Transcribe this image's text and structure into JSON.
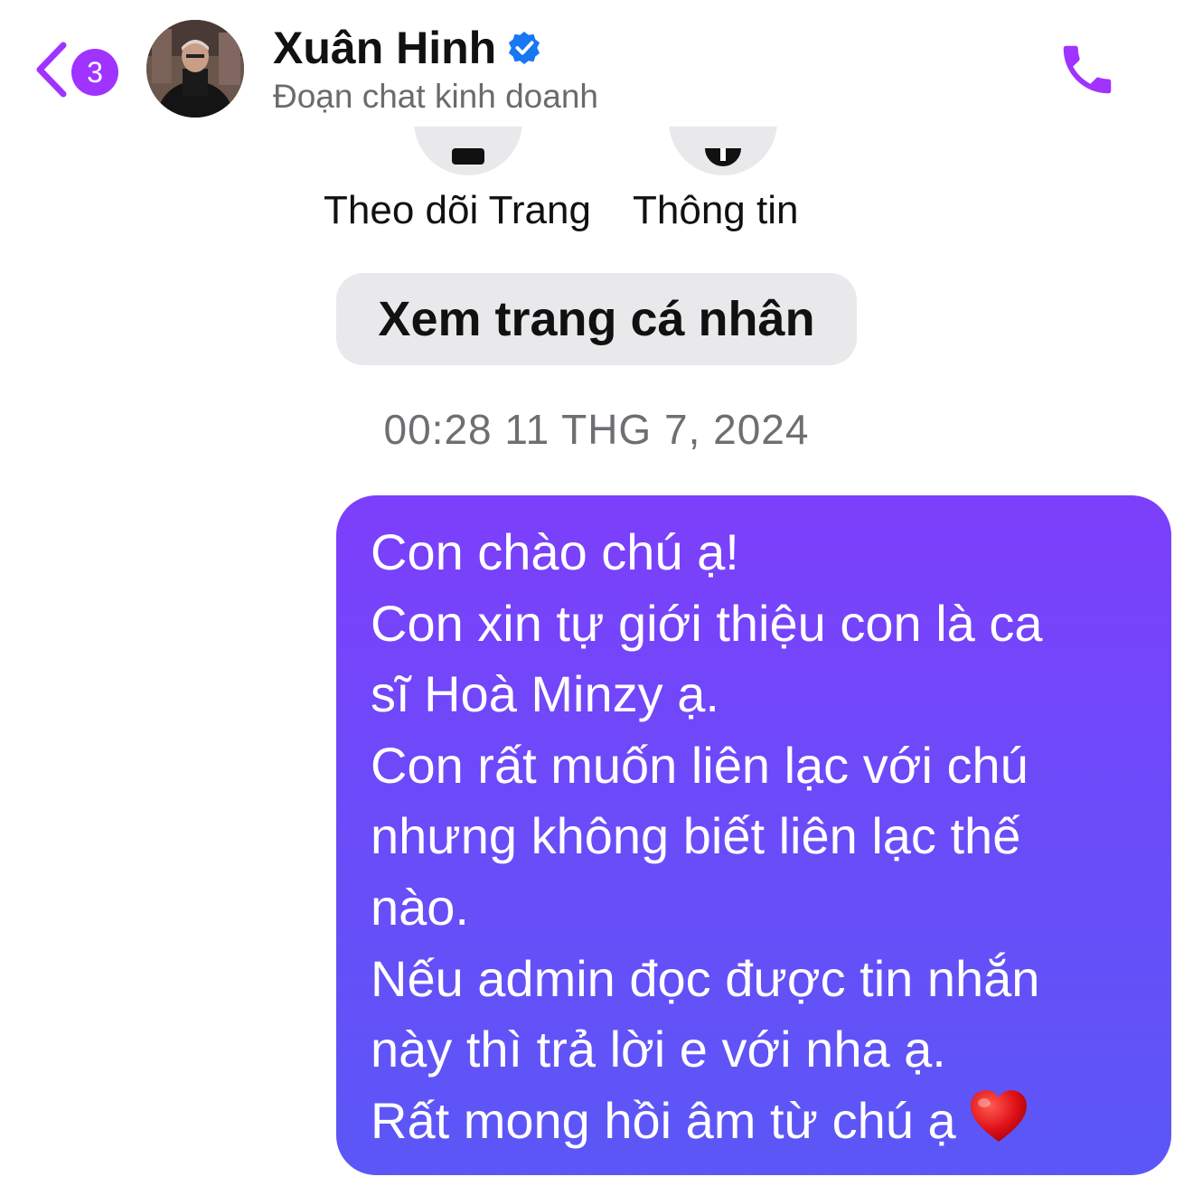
{
  "header": {
    "unread_count": "3",
    "contact_name": "Xuân Hinh",
    "contact_subtitle": "Đoạn chat kinh doanh",
    "icons": {
      "back": "chevron-left-icon",
      "verified": "verified-badge-icon",
      "call": "phone-icon"
    }
  },
  "profile_actions": {
    "follow_label": "Theo dõi Trang",
    "info_label": "Thông tin",
    "view_profile_label": "Xem trang cá nhân"
  },
  "conversation": {
    "timestamp": "00:28 11 THG 7, 2024",
    "message": {
      "lines": [
        "Con chào chú ạ!",
        "Con xin tự giới thiệu con là ca",
        "sĩ Hoà Minzy ạ.",
        "Con rất muốn liên lạc với chú",
        "nhưng không biết liên lạc thế",
        "nào.",
        "Nếu admin đọc được tin nhắn",
        "này thì trả lời e với nha ạ.",
        "Rất mong hồi âm từ chú ạ"
      ],
      "emoji": "red-heart"
    }
  },
  "colors": {
    "accent": "#a033ff",
    "bubble_top": "#7d3ffb",
    "bubble_bottom": "#5b57f7",
    "verified": "#1877f2"
  }
}
